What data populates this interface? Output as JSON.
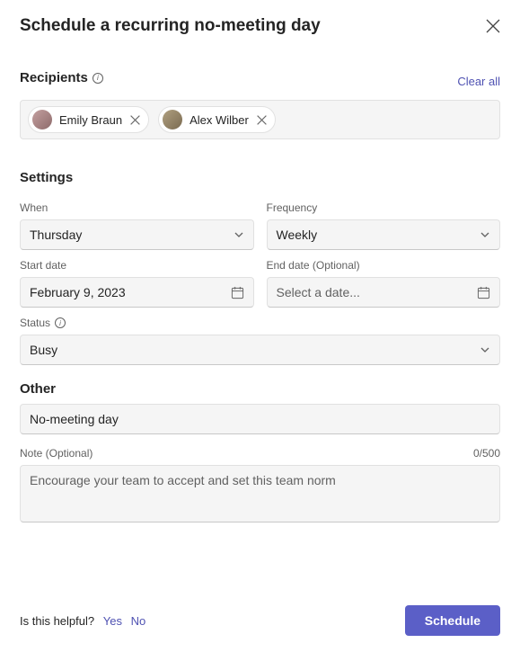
{
  "header": {
    "title": "Schedule a recurring no-meeting day"
  },
  "recipients": {
    "section_label": "Recipients",
    "clear_all": "Clear all",
    "chips": [
      {
        "name": "Emily Braun"
      },
      {
        "name": "Alex Wilber"
      }
    ]
  },
  "settings": {
    "section_label": "Settings",
    "when_label": "When",
    "when_value": "Thursday",
    "frequency_label": "Frequency",
    "frequency_value": "Weekly",
    "start_date_label": "Start date",
    "start_date_value": "February 9, 2023",
    "end_date_label": "End date (Optional)",
    "end_date_placeholder": "Select a date...",
    "status_label": "Status",
    "status_value": "Busy"
  },
  "other": {
    "section_label": "Other",
    "title_value": "No-meeting day",
    "note_label": "Note (Optional)",
    "note_counter": "0/500",
    "note_placeholder": "Encourage your team to accept and set this team norm"
  },
  "footer": {
    "helpful_text": "Is this helpful?",
    "yes": "Yes",
    "no": "No",
    "schedule_button": "Schedule"
  }
}
